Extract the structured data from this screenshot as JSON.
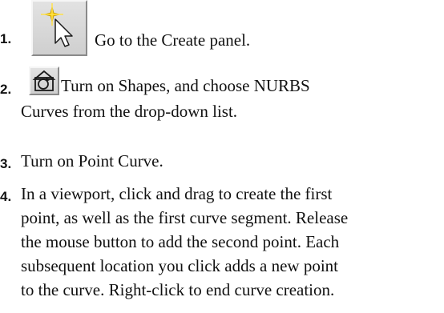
{
  "steps": [
    {
      "number": "1.",
      "icon": "create-panel-arrow-icon",
      "lines": [
        "Go to the Create panel."
      ]
    },
    {
      "number": "2.",
      "icon": "shapes-icon",
      "lines": [
        "Turn on Shapes, and choose NURBS",
        "Curves from the drop-down list."
      ]
    },
    {
      "number": "3.",
      "lines": [
        "Turn on Point Curve."
      ]
    },
    {
      "number": "4.",
      "lines": [
        "In a viewport, click and drag to create the first",
        "point, as well as the first curve segment. Release",
        "the mouse button to add the second point. Each",
        "subsequent location you click adds a new point",
        "to the curve. Right-click to end curve creation."
      ]
    }
  ]
}
